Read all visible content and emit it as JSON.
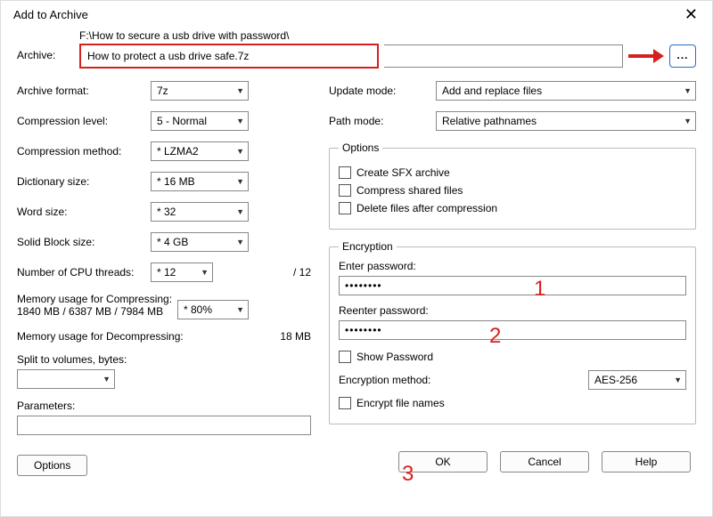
{
  "title": "Add to Archive",
  "archive": {
    "label": "Archive:",
    "folder": "F:\\How to secure a usb drive with password\\",
    "name": "How to protect a usb drive safe.7z",
    "browse": "..."
  },
  "left": {
    "format_label": "Archive format:",
    "format": "7z",
    "level_label": "Compression level:",
    "level": "5 - Normal",
    "method_label": "Compression method:",
    "method": "* LZMA2",
    "dict_label": "Dictionary size:",
    "dict": "* 16 MB",
    "word_label": "Word size:",
    "word": "* 32",
    "block_label": "Solid Block size:",
    "block": "* 4 GB",
    "threads_label": "Number of CPU threads:",
    "threads": "* 12",
    "threads_total": "/ 12",
    "mem_comp_label": "Memory usage for Compressing:",
    "mem_comp_detail": "1840 MB / 6387 MB / 7984 MB",
    "mem_pct": "* 80%",
    "mem_decomp_label": "Memory usage for Decompressing:",
    "mem_decomp_val": "18 MB",
    "split_label": "Split to volumes, bytes:",
    "split_val": "",
    "params_label": "Parameters:",
    "params_val": "",
    "options_btn": "Options"
  },
  "right": {
    "update_label": "Update mode:",
    "update": "Add and replace files",
    "path_label": "Path mode:",
    "path": "Relative pathnames",
    "options_group": "Options",
    "sfx": "Create SFX archive",
    "shared": "Compress shared files",
    "delete": "Delete files after compression",
    "enc_group": "Encryption",
    "enter_pw": "Enter password:",
    "reenter_pw": "Reenter password:",
    "pw_dots": "••••••••",
    "show_pw": "Show Password",
    "enc_method_label": "Encryption method:",
    "enc_method": "AES-256",
    "enc_names": "Encrypt file names"
  },
  "buttons": {
    "ok": "OK",
    "cancel": "Cancel",
    "help": "Help"
  },
  "annot": {
    "a1": "1",
    "a2": "2",
    "a3": "3"
  }
}
